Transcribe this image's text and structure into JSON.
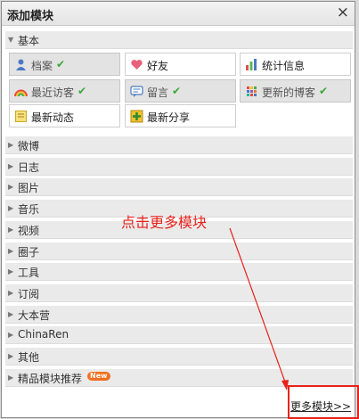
{
  "dialog": {
    "title": "添加模块",
    "close_glyph": "×"
  },
  "basic": {
    "label": "基本",
    "modules": [
      {
        "name": "档案",
        "icon": "profile-icon",
        "added": true
      },
      {
        "name": "好友",
        "icon": "heart-icon",
        "added": false
      },
      {
        "name": "统计信息",
        "icon": "bar-chart-icon",
        "added": false
      },
      {
        "name": "最近访客",
        "icon": "rainbow-icon",
        "added": true
      },
      {
        "name": "留言",
        "icon": "message-icon",
        "added": true
      },
      {
        "name": "更新的博客",
        "icon": "dots-grid-icon",
        "added": true
      },
      {
        "name": "最新动态",
        "icon": "note-icon",
        "added": false
      },
      {
        "name": "最新分享",
        "icon": "plus-icon",
        "added": false
      }
    ]
  },
  "sections": [
    "微博",
    "日志",
    "图片",
    "音乐",
    "视频",
    "圈子",
    "工具",
    "订阅",
    "大本营",
    "ChinaRen",
    "其他",
    "精品模块推荐"
  ],
  "new_badge": "New",
  "more_link": "更多模块>>",
  "annotation": "点击更多模块",
  "colors": {
    "annotation_red": "#e8221b",
    "check_green": "#3aa83a",
    "badge_orange": "#ef6f1f"
  }
}
